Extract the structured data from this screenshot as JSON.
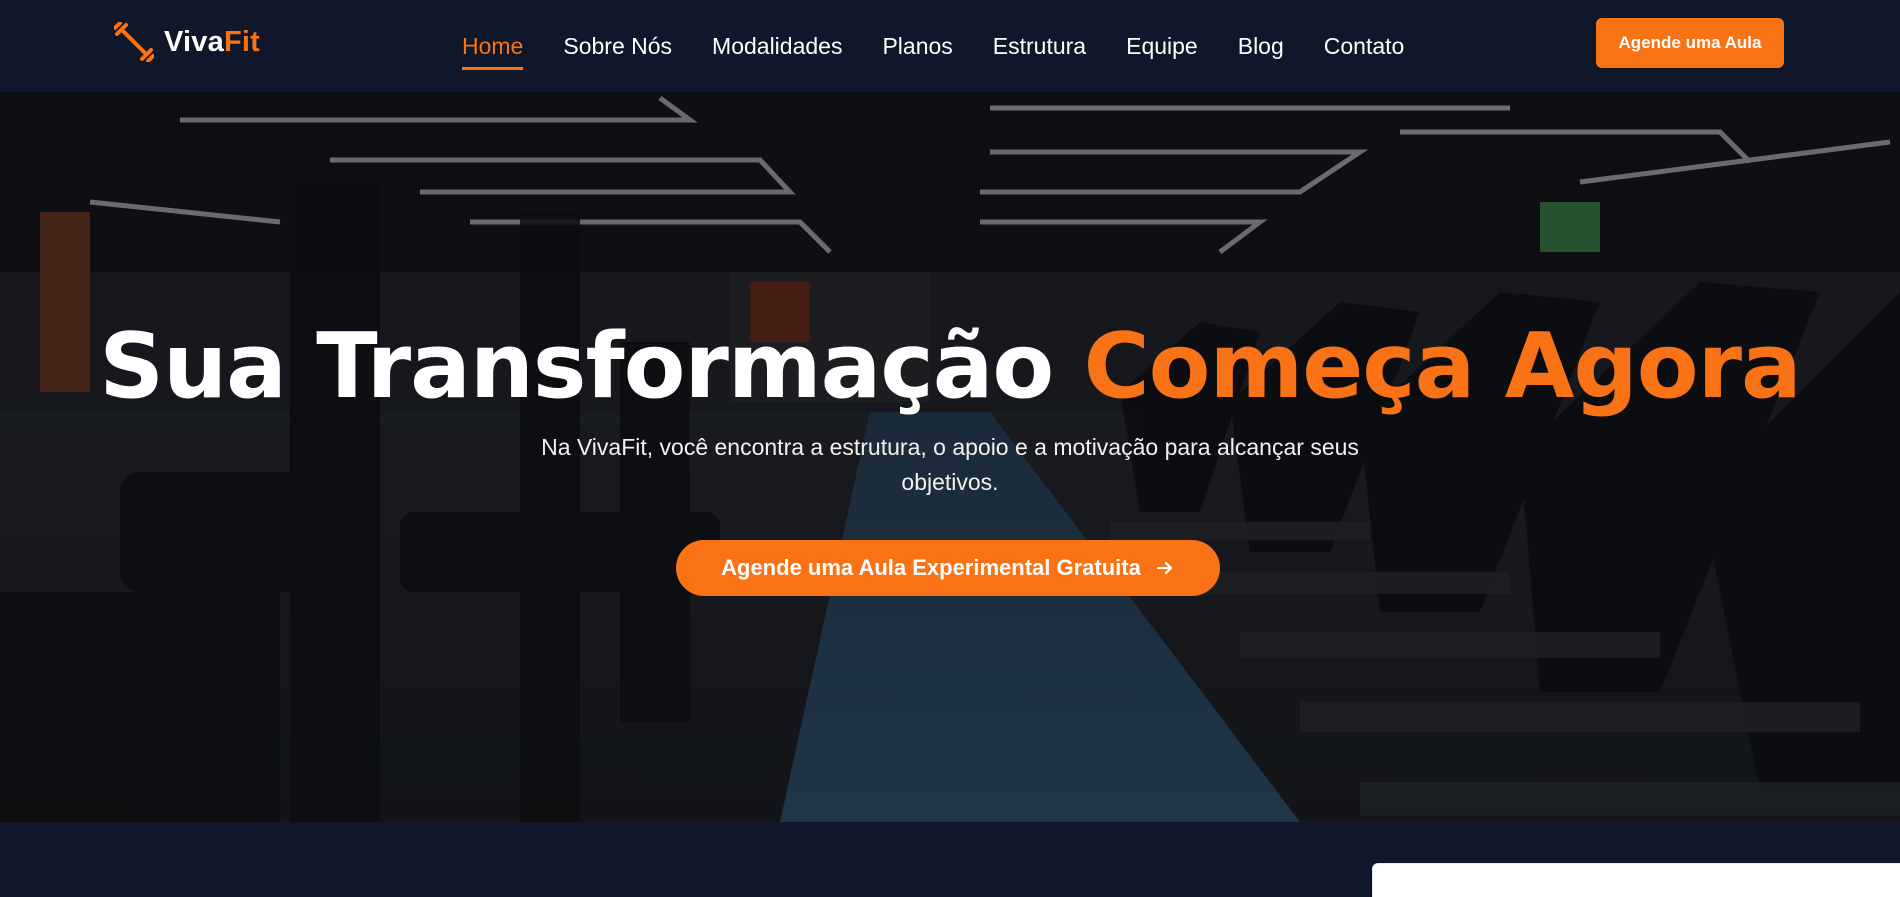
{
  "brand": {
    "name_part1": "Viva",
    "name_part2": "Fit",
    "icon": "dumbbell-icon",
    "accent_color": "#f97316"
  },
  "nav": {
    "items": [
      {
        "label": "Home",
        "active": true
      },
      {
        "label": "Sobre Nós",
        "active": false
      },
      {
        "label": "Modalidades",
        "active": false
      },
      {
        "label": "Planos",
        "active": false
      },
      {
        "label": "Estrutura",
        "active": false
      },
      {
        "label": "Equipe",
        "active": false
      },
      {
        "label": "Blog",
        "active": false
      },
      {
        "label": "Contato",
        "active": false
      }
    ],
    "cta_label": "Agende uma Aula"
  },
  "hero": {
    "title_part1": "Sua Transformação",
    "title_part2": "Começa Agora",
    "subtitle": "Na VivaFit, você encontra a estrutura, o apoio e a motivação para alcançar seus objetivos.",
    "cta_label": "Agende uma Aula Experimental Gratuita",
    "cta_icon": "arrow-right-icon",
    "background": "gym-interior-photo"
  },
  "colors": {
    "navbar_bg": "#10172a",
    "accent": "#f97316",
    "text": "#ffffff"
  }
}
